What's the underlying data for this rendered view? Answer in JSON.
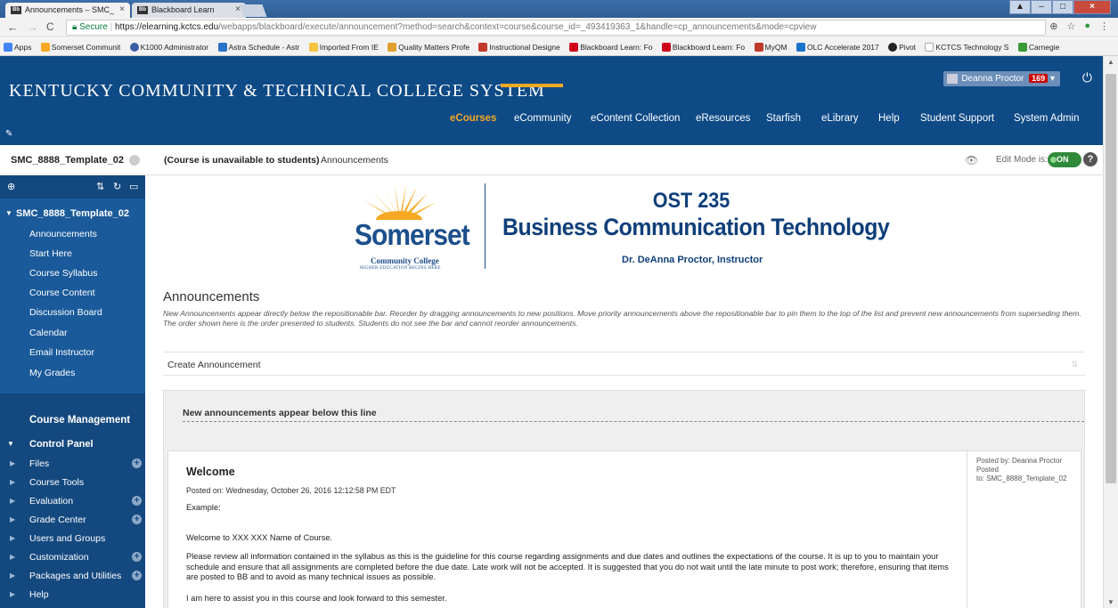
{
  "browser": {
    "tabs": [
      {
        "label": "Announcements – SMC_",
        "favicon": "Bb"
      },
      {
        "label": "Blackboard Learn",
        "favicon": "Bb"
      }
    ],
    "secure_label": "Secure",
    "url_host": "https://elearning.kctcs.edu",
    "url_path": "/webapps/blackboard/execute/announcement?method=search&context=course&course_id=_493419363_1&handle=cp_announcements&mode=cpview",
    "bookmarks": [
      {
        "label": "Apps",
        "color": "#4285f4"
      },
      {
        "label": "Somerset Communit",
        "color": "#f7a823"
      },
      {
        "label": "K1000 Administrator",
        "color": "#3b5ea8"
      },
      {
        "label": "Astra Schedule - Astr",
        "color": "#2a73c9"
      },
      {
        "label": "Imported From IE",
        "color": "#f5c242"
      },
      {
        "label": "Quality Matters Profe",
        "color": "#e0a030"
      },
      {
        "label": "Instructional Designe",
        "color": "#c0392b"
      },
      {
        "label": "Blackboard Learn: Fo",
        "color": "#d0021b"
      },
      {
        "label": "Blackboard Learn: Fo",
        "color": "#d0021b"
      },
      {
        "label": "MyQM",
        "color": "#c0392b"
      },
      {
        "label": "OLC Accelerate 2017",
        "color": "#1a73c9"
      },
      {
        "label": "Pivot",
        "color": "#222"
      },
      {
        "label": "KCTCS Technology S",
        "color": "#aaa"
      },
      {
        "label": "Carnegie",
        "color": "#3a9a3a"
      }
    ]
  },
  "header": {
    "title": "KENTUCKY COMMUNITY & TECHNICAL COLLEGE SYSTEM",
    "user_name": "Deanna Proctor",
    "notification_count": "169",
    "nav": [
      "eCourses",
      "eCommunity",
      "eContent Collection",
      "eResources",
      "Starfish",
      "eLibrary",
      "Help",
      "Student Support",
      "System Admin"
    ]
  },
  "breadcrumb": {
    "course": "SMC_8888_Template_02",
    "status": "(Course is unavailable to students)",
    "page": "Announcements",
    "edit_mode_label": "Edit Mode is:",
    "edit_mode_value": "ON"
  },
  "sidebar": {
    "course_name": "SMC_8888_Template_02",
    "links": [
      "Announcements",
      "Start Here",
      "Course Syllabus",
      "Course Content",
      "Discussion Board",
      "Calendar",
      "Email Instructor",
      "My Grades"
    ],
    "course_management": "Course Management",
    "control_panel": "Control Panel",
    "cp_items": [
      {
        "label": "Files",
        "plus": true
      },
      {
        "label": "Course Tools",
        "plus": false
      },
      {
        "label": "Evaluation",
        "plus": true
      },
      {
        "label": "Grade Center",
        "plus": true
      },
      {
        "label": "Users and Groups",
        "plus": false
      },
      {
        "label": "Customization",
        "plus": true
      },
      {
        "label": "Packages and Utilities",
        "plus": true
      },
      {
        "label": "Help",
        "plus": false
      }
    ]
  },
  "banner": {
    "college": "Somerset",
    "college_sub": "Community College",
    "tagline": "HIGHER EDUCATION BEGINS HERE",
    "course_code": "OST 235",
    "course_title": "Business Communication Technology",
    "instructor": "Dr. DeAnna Proctor, Instructor"
  },
  "announcements": {
    "heading": "Announcements",
    "description": "New Announcements appear directly below the repositionable bar. Reorder by dragging announcements to new positions. Move priority announcements above the repositionable bar to pin them to the top of the list and prevent new announcements from superseding them. The order shown here is the order presented to students. Students do not see the bar and cannot reorder announcements.",
    "create_label": "Create Announcement",
    "new_line_label": "New announcements appear below this line",
    "item": {
      "title": "Welcome",
      "posted_on": "Posted on: Wednesday, October 26, 2016 12:12:58 PM EDT",
      "posted_by": "Posted by: Deanna Proctor",
      "posted_to_label": "Posted",
      "posted_to": "to: SMC_8888_Template_02",
      "paragraphs": [
        "Example:",
        "Welcome to XXX XXX Name of Course.",
        "Please review all information contained in the syllabus as this is the guideline for this course regarding assignments and due dates and outlines the expectations of the course. It is up to you to maintain your schedule and ensure that all assignments are completed before the due date. Late work will not be accepted. It is suggested that you do not wait until the late minute to post work; therefore, ensuring that items are posted to BB and to avoid as many technical issues as possible.",
        "I am here to assist you in this course and look forward to this semester."
      ]
    }
  }
}
